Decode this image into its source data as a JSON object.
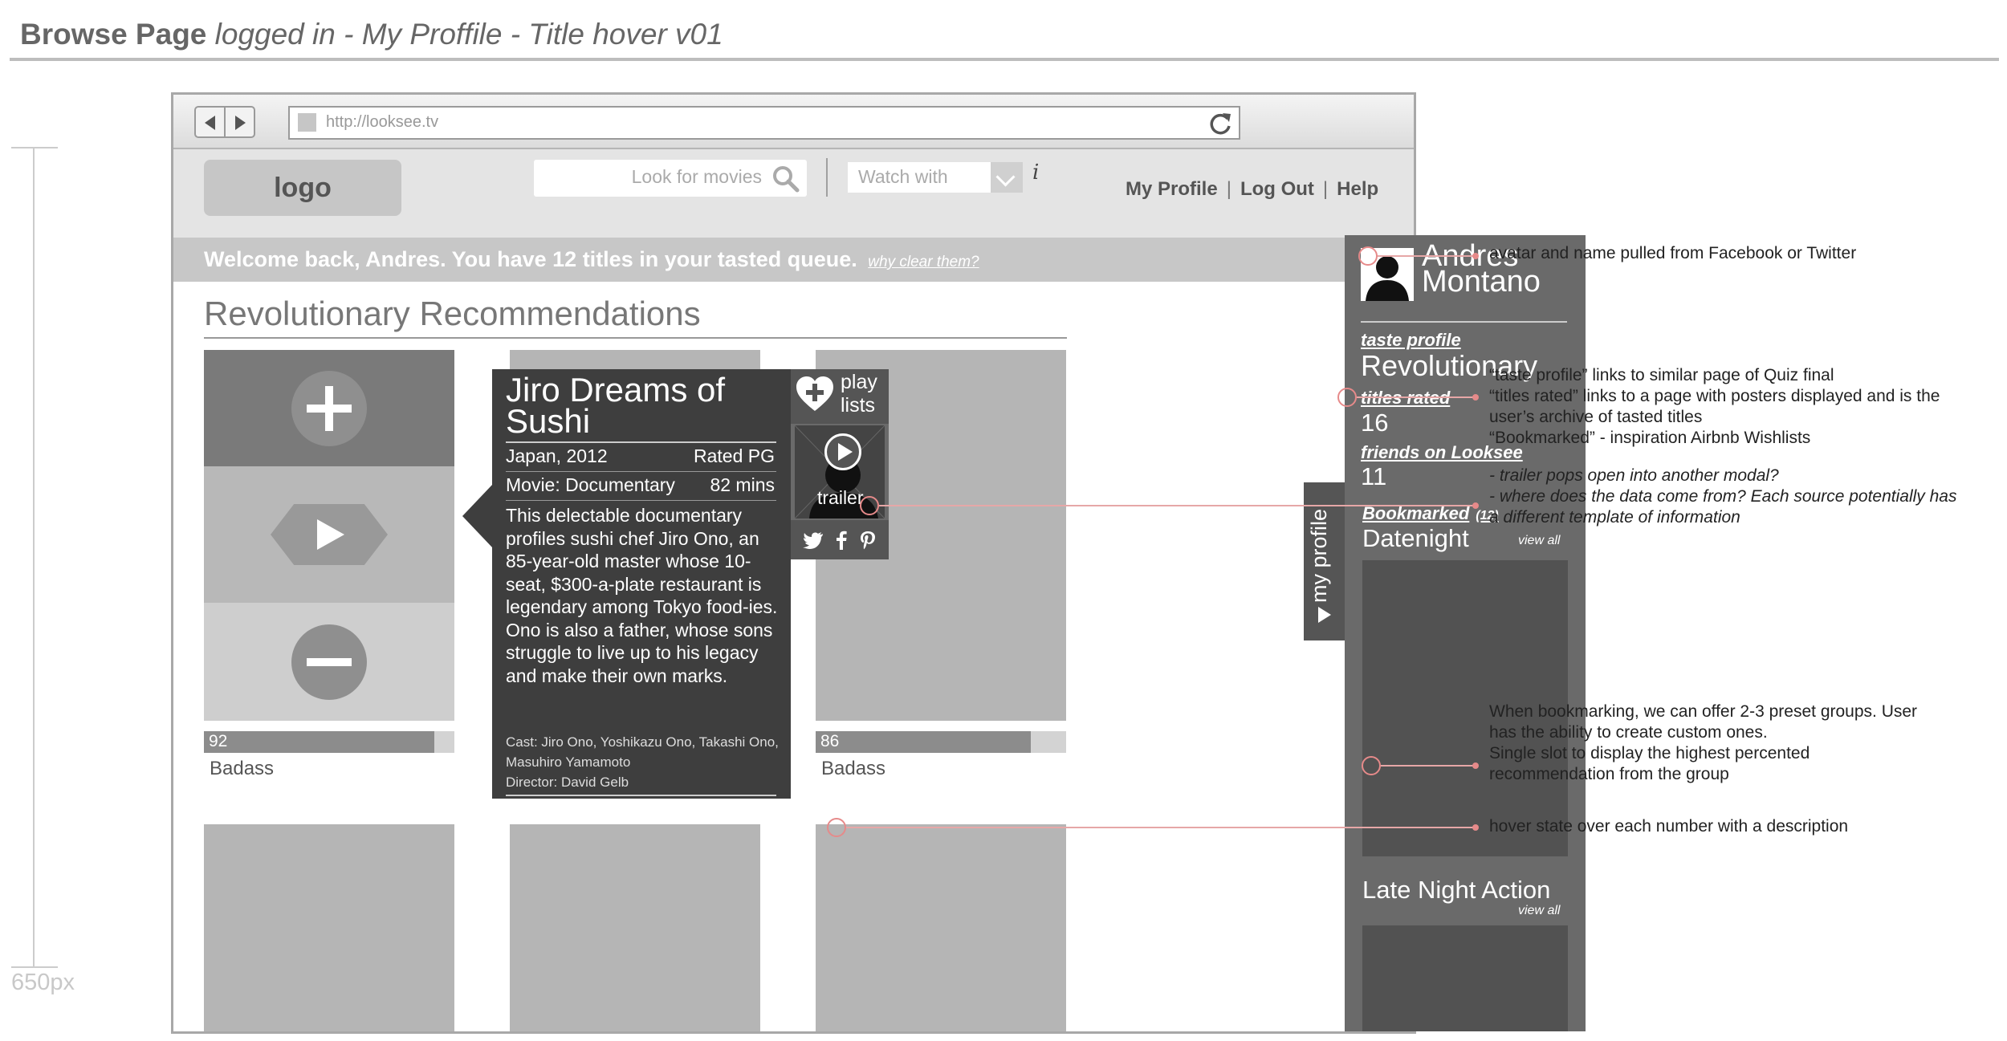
{
  "page": {
    "title_bold": "Browse Page",
    "title_italic": "logged in - My Proffile - Title hover v01",
    "ruler_label": "650px"
  },
  "browser": {
    "url": "http://looksee.tv"
  },
  "header": {
    "logo": "logo",
    "search_placeholder": "Look for movies",
    "watch_with": "Watch with",
    "info": "i",
    "nav": [
      "My Profile",
      "Log Out",
      "Help"
    ],
    "nav_sep": "|"
  },
  "welcome": {
    "text": "Welcome back, Andres. You have 12 titles in your tasted queue.",
    "link": "why clear them?"
  },
  "section": {
    "heading": "Revolutionary Recommendations"
  },
  "cards": [
    {
      "score": 92,
      "label": "Badass"
    },
    {
      "score": 86,
      "label": "Badass"
    }
  ],
  "popup": {
    "title": "Jiro Dreams of Sushi",
    "country_year": "Japan, 2012",
    "rating": "Rated PG",
    "genre": "Movie: Documentary",
    "duration": "82 mins",
    "description": "This delectable documentary profiles sushi chef Jiro Ono, an 85-year-old master whose 10-seat, $300-a-plate restaurant is legendary among Tokyo food-ies. Ono is also a father, whose sons struggle to live up to his legacy and make their own marks.",
    "cast": "Cast: Jiro Ono, Yoshikazu Ono, Takashi Ono, Masuhiro Yamamoto",
    "director": "Director: David Gelb",
    "playlists": "play lists",
    "trailer": "trailer",
    "social": [
      "twitter-icon",
      "facebook-icon",
      "pinterest-icon"
    ]
  },
  "profile_tab": {
    "label": "my profile"
  },
  "profile": {
    "name": "Andres Montano",
    "taste_profile_label": "taste profile",
    "taste_profile_value": "Revolutionary",
    "titles_rated_label": "titles rated",
    "titles_rated_value": "16",
    "friends_label": "friends on Looksee",
    "friends_value": "11",
    "bookmarked_label": "Bookmarked",
    "bookmarked_count": "(12)",
    "groups": [
      {
        "name": "Datenight",
        "view_all": "view all"
      },
      {
        "name": "Late Night Action",
        "view_all": "view all"
      }
    ]
  },
  "annotations": {
    "avatar": "avatar and name pulled from Facebook or Twitter",
    "taste_1": "“taste profile” links to similar page of Quiz final",
    "taste_2": "“titles rated” links to a page with posters displayed and is the",
    "taste_3": "user’s archive of tasted titles",
    "taste_4": "“Bookmarked” - inspiration Airbnb Wishlists",
    "trailer_1": "- trailer pops open into another modal?",
    "trailer_2": "- where does the data come from? Each source potentially has",
    "trailer_3": "a different template of information",
    "bookmark_1": "When bookmarking, we can offer 2-3 preset groups. User",
    "bookmark_2": "has the ability to create custom ones.",
    "bookmark_3": "Single slot to display the highest percented",
    "bookmark_4": "recommendation from the group",
    "hover": "hover state over each number with a description"
  },
  "colors": {
    "panel_dark": "#6a6a6a",
    "popup_bg": "#3e3e3e",
    "annotation_line": "#e6a7a7"
  }
}
